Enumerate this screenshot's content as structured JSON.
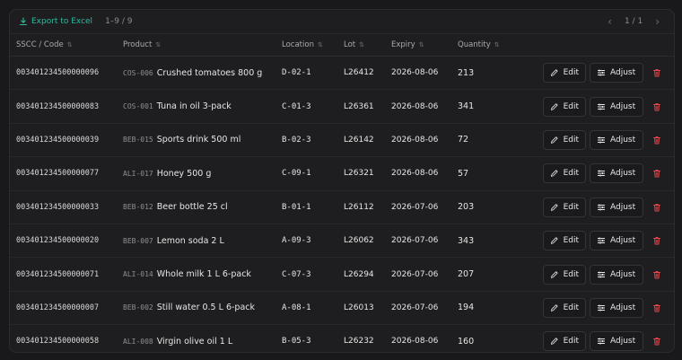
{
  "toolbar": {
    "export_label": "Export to Excel",
    "count": "1–9 / 9",
    "page": "1 / 1",
    "prev_icon": "chevron-left-icon",
    "next_icon": "chevron-right-icon"
  },
  "columns": {
    "sscc": "SSCC / Code",
    "product": "Product",
    "location": "Location",
    "lot": "Lot",
    "expiry": "Expiry",
    "quantity": "Quantity"
  },
  "actions": {
    "edit": "Edit",
    "adjust": "Adjust"
  },
  "colors": {
    "accent": "#2fb99e",
    "danger": "#e5484d"
  },
  "rows": [
    {
      "sscc": "003401234500000096",
      "code": "COS-006",
      "name": "Crushed tomatoes 800 g",
      "location": "D-02-1",
      "lot": "L26412",
      "expiry": "2026-08-06",
      "quantity": "213"
    },
    {
      "sscc": "003401234500000083",
      "code": "COS-001",
      "name": "Tuna in oil 3-pack",
      "location": "C-01-3",
      "lot": "L26361",
      "expiry": "2026-08-06",
      "quantity": "341"
    },
    {
      "sscc": "003401234500000039",
      "code": "BEB-015",
      "name": "Sports drink 500 ml",
      "location": "B-02-3",
      "lot": "L26142",
      "expiry": "2026-08-06",
      "quantity": "72"
    },
    {
      "sscc": "003401234500000077",
      "code": "ALI-017",
      "name": "Honey 500 g",
      "location": "C-09-1",
      "lot": "L26321",
      "expiry": "2026-08-06",
      "quantity": "57"
    },
    {
      "sscc": "003401234500000033",
      "code": "BEB-012",
      "name": "Beer bottle 25 cl",
      "location": "B-01-1",
      "lot": "L26112",
      "expiry": "2026-07-06",
      "quantity": "203"
    },
    {
      "sscc": "003401234500000020",
      "code": "BEB-007",
      "name": "Lemon soda 2 L",
      "location": "A-09-3",
      "lot": "L26062",
      "expiry": "2026-07-06",
      "quantity": "343"
    },
    {
      "sscc": "003401234500000071",
      "code": "ALI-014",
      "name": "Whole milk 1 L 6-pack",
      "location": "C-07-3",
      "lot": "L26294",
      "expiry": "2026-07-06",
      "quantity": "207"
    },
    {
      "sscc": "003401234500000007",
      "code": "BEB-002",
      "name": "Still water 0.5 L 6-pack",
      "location": "A-08-1",
      "lot": "L26013",
      "expiry": "2026-07-06",
      "quantity": "194"
    },
    {
      "sscc": "003401234500000058",
      "code": "ALI-008",
      "name": "Virgin olive oil 1 L",
      "location": "B-05-3",
      "lot": "L26232",
      "expiry": "2026-08-06",
      "quantity": "160"
    }
  ]
}
